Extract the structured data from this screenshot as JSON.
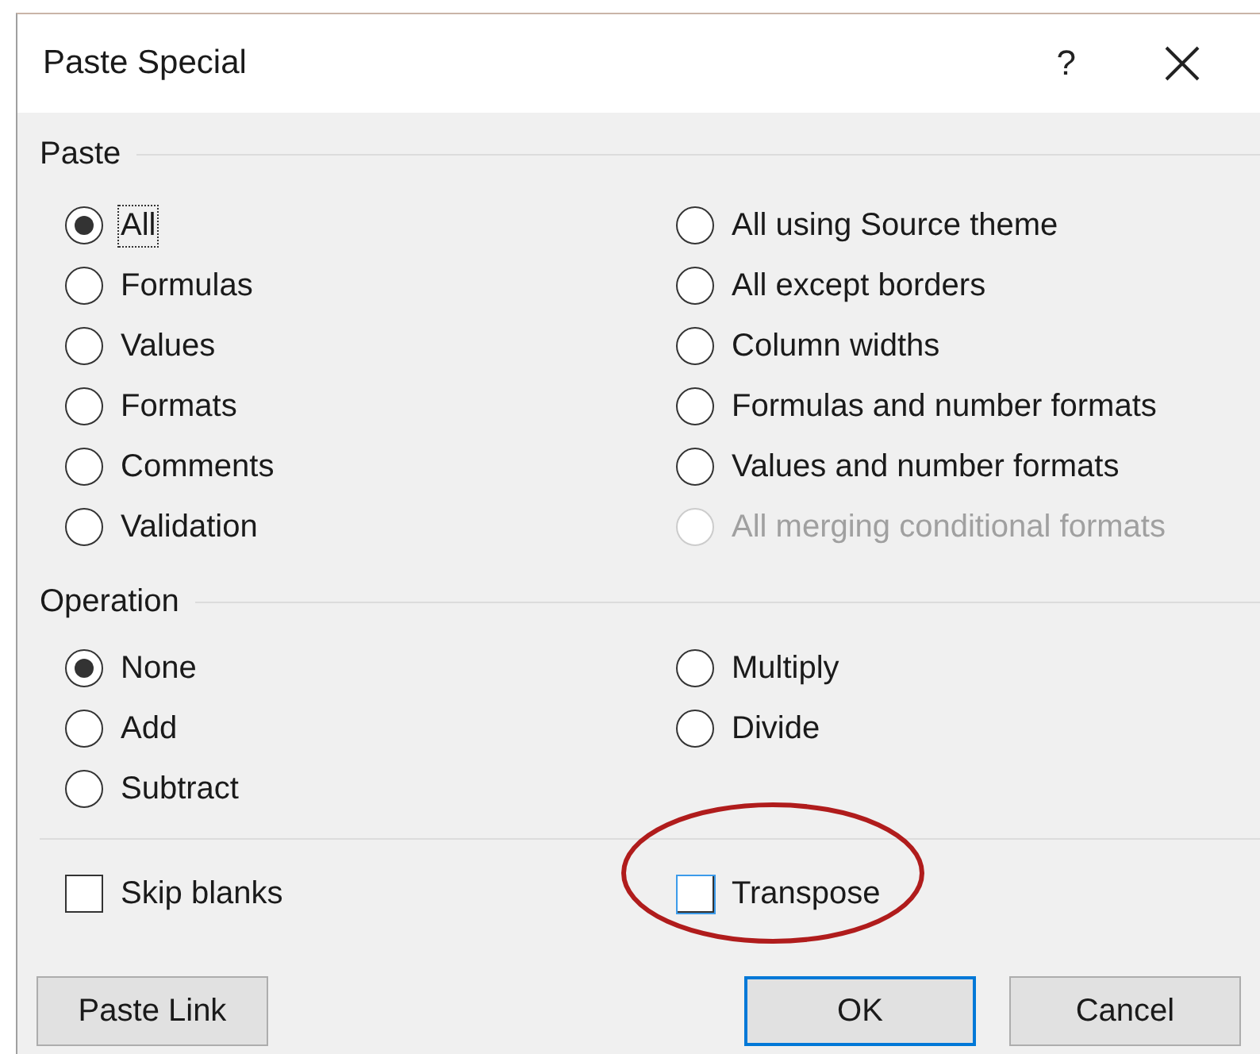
{
  "window": {
    "title": "Paste Special",
    "help": "?"
  },
  "paste": {
    "label": "Paste",
    "options": [
      {
        "label": "All",
        "selected": true,
        "disabled": false,
        "focused": true
      },
      {
        "label": "Formulas",
        "selected": false,
        "disabled": false,
        "focused": false
      },
      {
        "label": "Values",
        "selected": false,
        "disabled": false,
        "focused": false
      },
      {
        "label": "Formats",
        "selected": false,
        "disabled": false,
        "focused": false
      },
      {
        "label": "Comments",
        "selected": false,
        "disabled": false,
        "focused": false
      },
      {
        "label": "Validation",
        "selected": false,
        "disabled": false,
        "focused": false
      },
      {
        "label": "All using Source theme",
        "selected": false,
        "disabled": false,
        "focused": false
      },
      {
        "label": "All except borders",
        "selected": false,
        "disabled": false,
        "focused": false
      },
      {
        "label": "Column widths",
        "selected": false,
        "disabled": false,
        "focused": false
      },
      {
        "label": "Formulas and number formats",
        "selected": false,
        "disabled": false,
        "focused": false
      },
      {
        "label": "Values and number formats",
        "selected": false,
        "disabled": false,
        "focused": false
      },
      {
        "label": "All merging conditional formats",
        "selected": false,
        "disabled": true,
        "focused": false
      }
    ]
  },
  "operation": {
    "label": "Operation",
    "options": [
      {
        "label": "None",
        "selected": true
      },
      {
        "label": "Add",
        "selected": false
      },
      {
        "label": "Subtract",
        "selected": false
      },
      {
        "label": "Multiply",
        "selected": false
      },
      {
        "label": "Divide",
        "selected": false
      }
    ]
  },
  "checkboxes": [
    {
      "label": "Skip blanks",
      "checked": false,
      "hovered": false,
      "highlighted": false
    },
    {
      "label": "Transpose",
      "checked": false,
      "hovered": true,
      "highlighted": true
    }
  ],
  "buttons": [
    {
      "label": "Paste Link",
      "default": false
    },
    {
      "label": "OK",
      "default": true
    },
    {
      "label": "Cancel",
      "default": false
    }
  ]
}
